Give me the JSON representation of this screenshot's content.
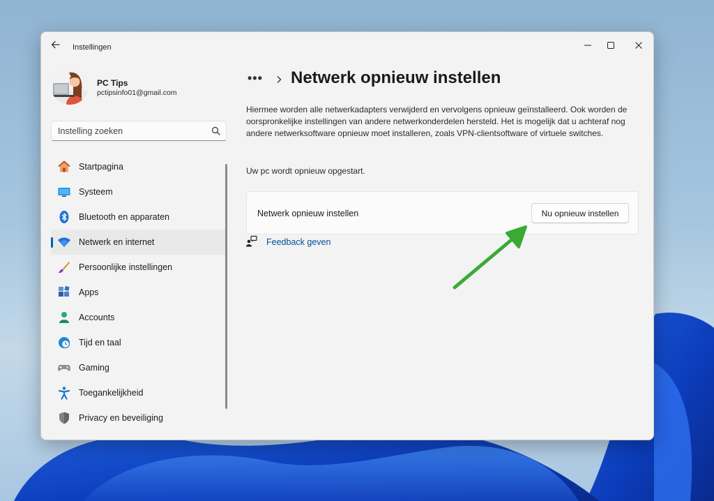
{
  "window": {
    "title": "Instellingen"
  },
  "profile": {
    "name": "PC Tips",
    "email": "pctipsinfo01@gmail.com"
  },
  "search": {
    "placeholder": "Instelling zoeken"
  },
  "sidebar": {
    "items": [
      {
        "label": "Startpagina",
        "icon": "home-icon"
      },
      {
        "label": "Systeem",
        "icon": "system-icon"
      },
      {
        "label": "Bluetooth en apparaten",
        "icon": "bluetooth-icon"
      },
      {
        "label": "Netwerk en internet",
        "icon": "wifi-icon",
        "active": true
      },
      {
        "label": "Persoonlijke instellingen",
        "icon": "brush-icon"
      },
      {
        "label": "Apps",
        "icon": "apps-icon"
      },
      {
        "label": "Accounts",
        "icon": "accounts-icon"
      },
      {
        "label": "Tijd en taal",
        "icon": "clock-globe-icon"
      },
      {
        "label": "Gaming",
        "icon": "gamepad-icon"
      },
      {
        "label": "Toegankelijkheid",
        "icon": "accessibility-icon"
      },
      {
        "label": "Privacy en beveiliging",
        "icon": "shield-icon"
      }
    ]
  },
  "main": {
    "breadcrumb_more": "•••",
    "title": "Netwerk opnieuw instellen",
    "description": "Hiermee worden alle netwerkadapters verwijderd en vervolgens opnieuw geïnstalleerd. Ook worden de oorspronkelijke instellingen van andere netwerkonderdelen hersteld. Het is mogelijk dat u achteraf nog andere netwerksoftware opnieuw moet installeren, zoals VPN-clientsoftware of virtuele switches.",
    "restart_note": "Uw pc wordt opnieuw opgestart.",
    "card": {
      "label": "Netwerk opnieuw instellen",
      "button": "Nu opnieuw instellen"
    },
    "feedback": "Feedback geven"
  },
  "colors": {
    "accent": "#005fb8",
    "link": "#004e9a",
    "annotation_arrow": "#3aaa35"
  }
}
